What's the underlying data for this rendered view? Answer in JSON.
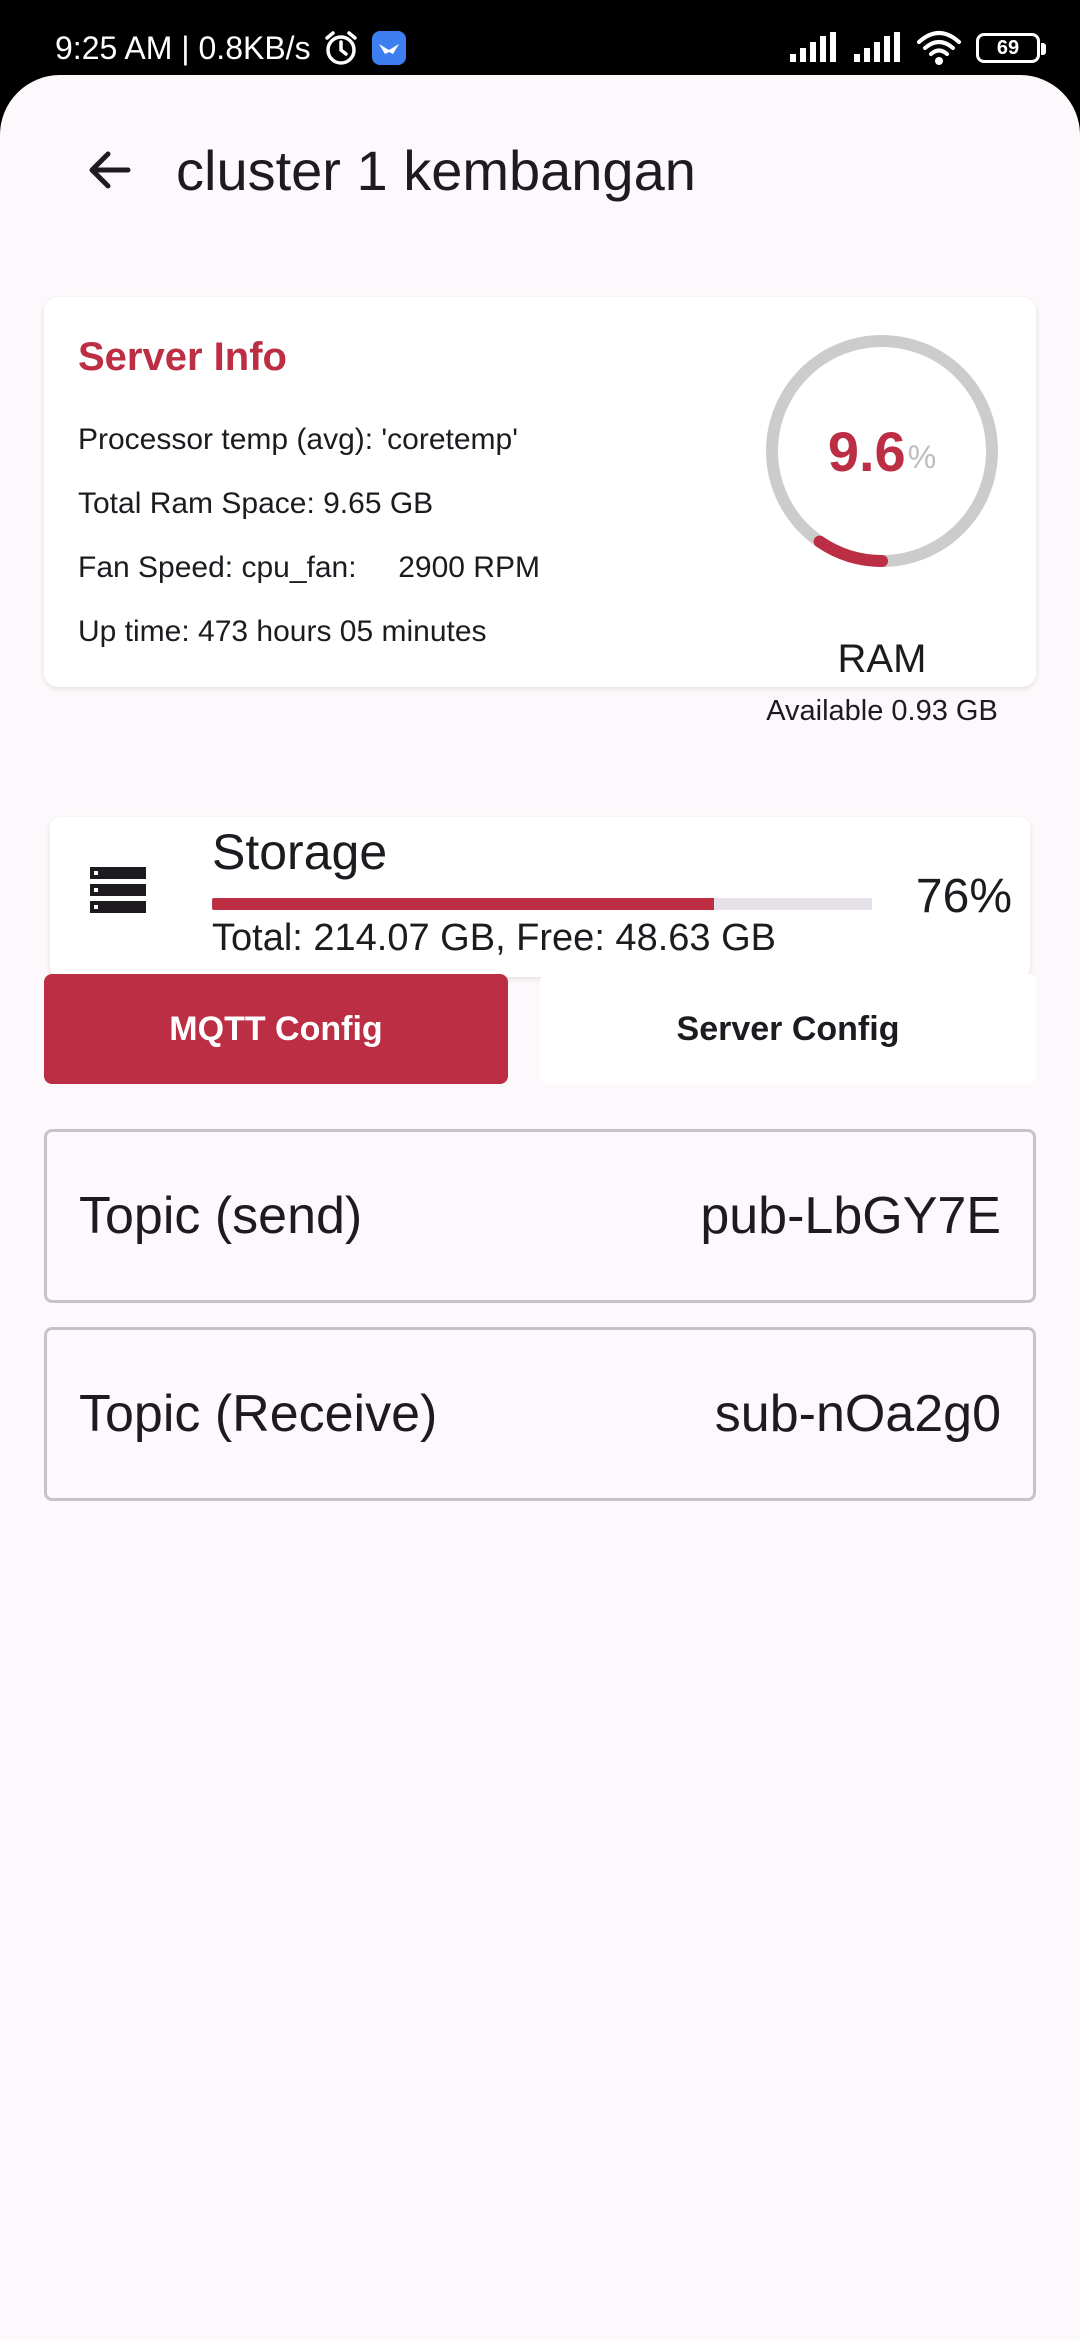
{
  "status_bar": {
    "time_speed": "9:25 AM | 0.8KB/s",
    "battery_level": "69",
    "icons": [
      "alarm-icon",
      "app-notification-icon",
      "signal-icon",
      "signal-icon",
      "wifi-icon",
      "battery-icon"
    ]
  },
  "app_bar": {
    "title": "cluster 1 kembangan",
    "back_icon": "arrow-left-icon"
  },
  "server_info": {
    "title": "Server Info",
    "lines": [
      "Processor temp (avg): 'coretemp'",
      "Total Ram Space: 9.65 GB",
      "Fan Speed: cpu_fan:     2900 RPM",
      "Up time: 473 hours 05 minutes"
    ],
    "ram": {
      "value": "9.6",
      "unit": "%",
      "percent": 9.6,
      "label": "RAM",
      "available": "Available 0.93 GB"
    }
  },
  "storage": {
    "title": "Storage",
    "detail": "Total: 214.07 GB, Free: 48.63 GB",
    "percent_label": "76%",
    "percent": 76,
    "icon": "storage-icon"
  },
  "tabs": [
    {
      "label": "MQTT Config",
      "active": true
    },
    {
      "label": "Server Config",
      "active": false
    }
  ],
  "fields": [
    {
      "label": "Topic (send)",
      "value": "pub-LbGY7E"
    },
    {
      "label": "Topic (Receive)",
      "value": "sub-nOa2g0"
    }
  ],
  "colors": {
    "accent": "#bb2e44",
    "background": "#fdf8fb",
    "text": "#1d1b20",
    "gauge_track": "#cccccc"
  }
}
